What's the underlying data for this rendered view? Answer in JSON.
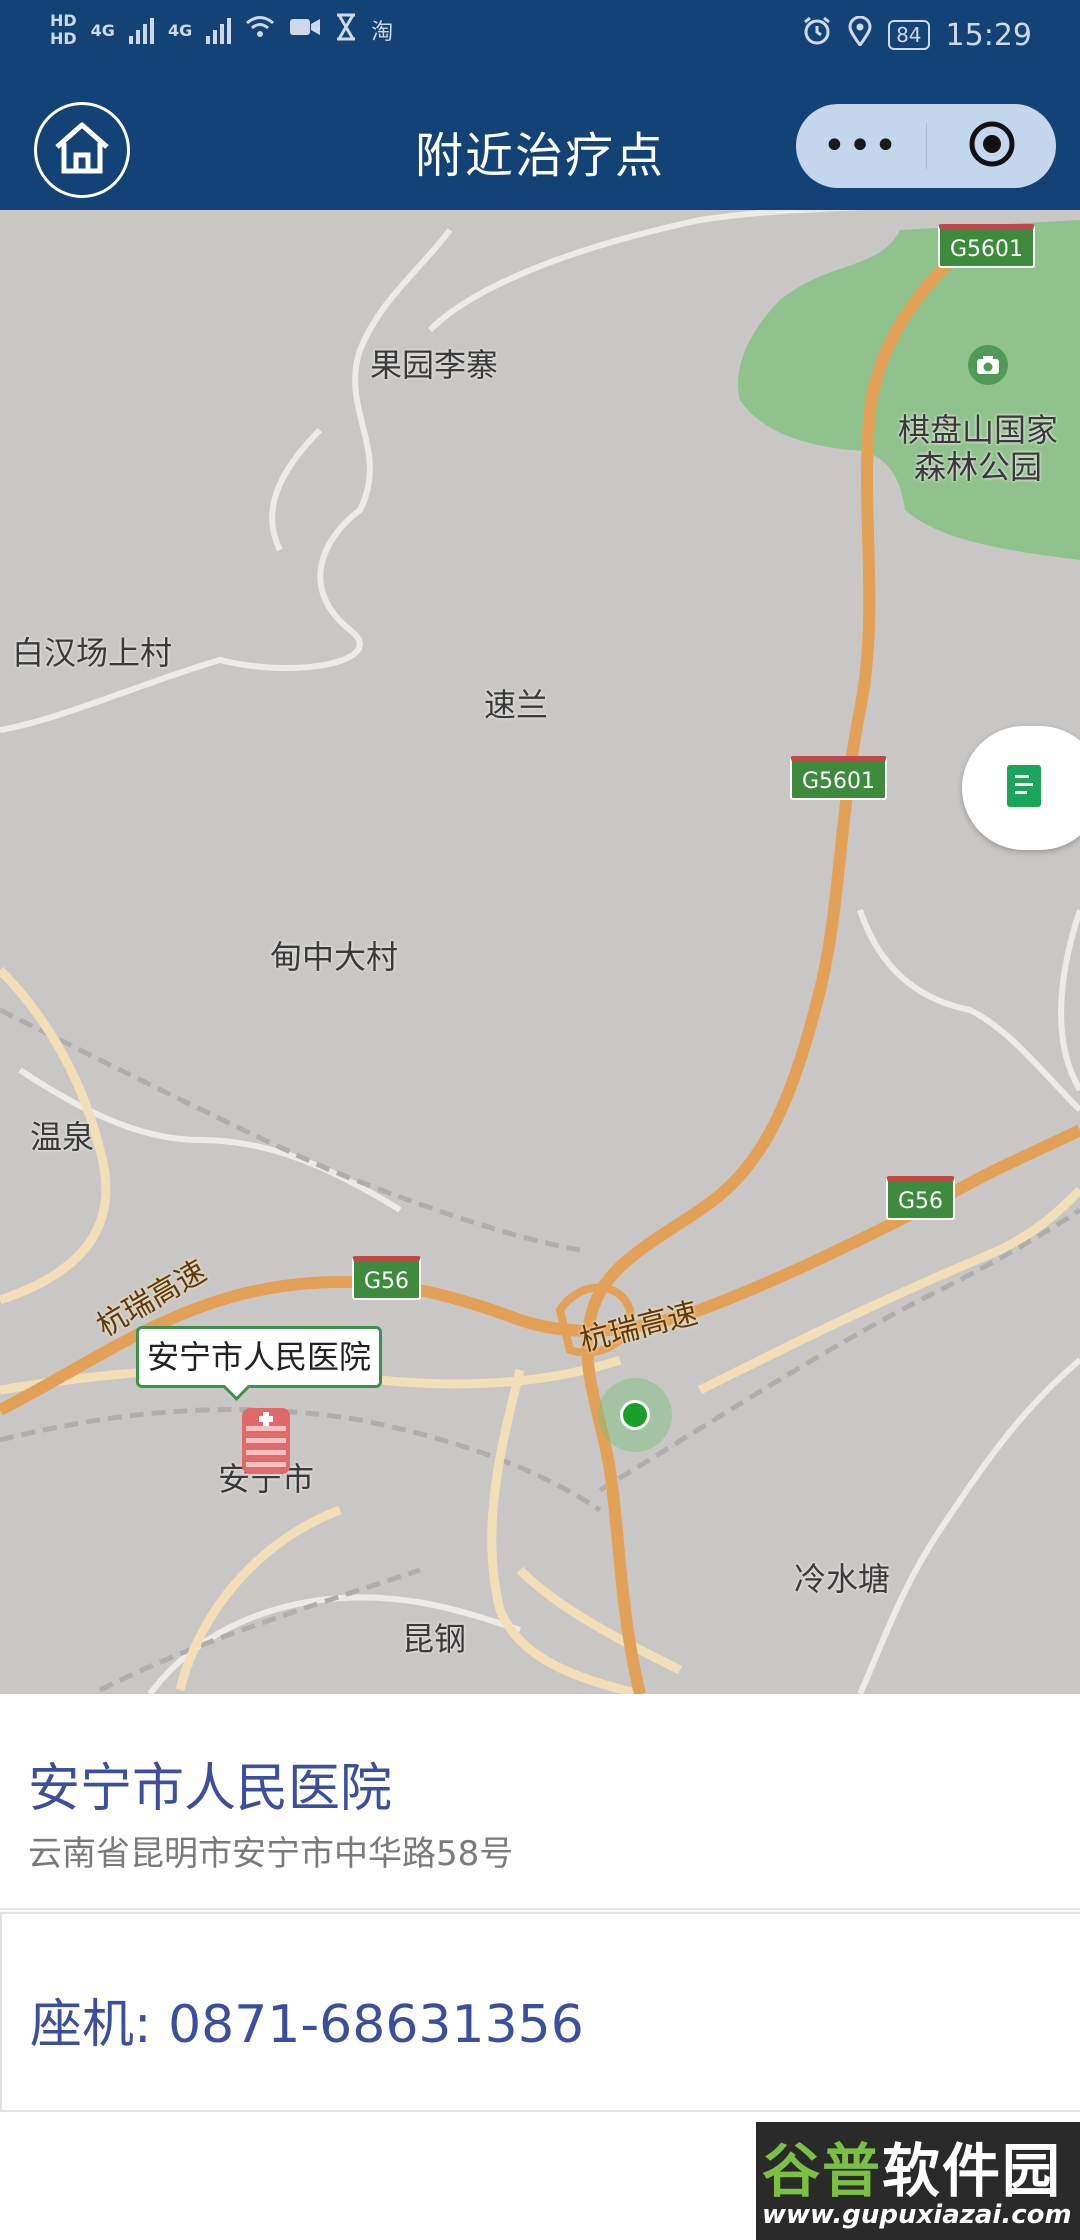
{
  "status_bar": {
    "network_left": [
      "HD",
      "HD",
      "4G",
      "4G"
    ],
    "extra_icons": [
      "wifi-icon",
      "video-icon",
      "hourglass-icon",
      "taobao-icon"
    ],
    "taobao_glyph": "淘",
    "right_icons": [
      "alarm-icon",
      "location-icon"
    ],
    "battery": "84",
    "time": "15:29"
  },
  "nav": {
    "title": "附近治疗点",
    "more_label": "•••"
  },
  "map": {
    "places": [
      "果园李寨",
      "棋盘山国家",
      "森林公园",
      "白汉场上村",
      "速兰",
      "甸中大村",
      "温泉",
      "安宁市",
      "冷水塘",
      "昆钢"
    ],
    "roads": [
      "杭瑞高速",
      "杭瑞高速"
    ],
    "shields": [
      "G5601",
      "G5601",
      "G56",
      "G56"
    ],
    "callout": "安宁市人民医院",
    "colors": {
      "land": "#c9c7c5",
      "park": "#8fc28c",
      "highway": "#e3a157",
      "road": "#f2dfb8"
    }
  },
  "info": {
    "name": "安宁市人民医院",
    "address": "云南省昆明市安宁市中华路58号"
  },
  "phone": {
    "label": "座机: ",
    "number": "0871-68631356"
  },
  "watermark": {
    "part1": "谷普",
    "part2": "软件园",
    "url": "www.gupuxiazai.com"
  }
}
